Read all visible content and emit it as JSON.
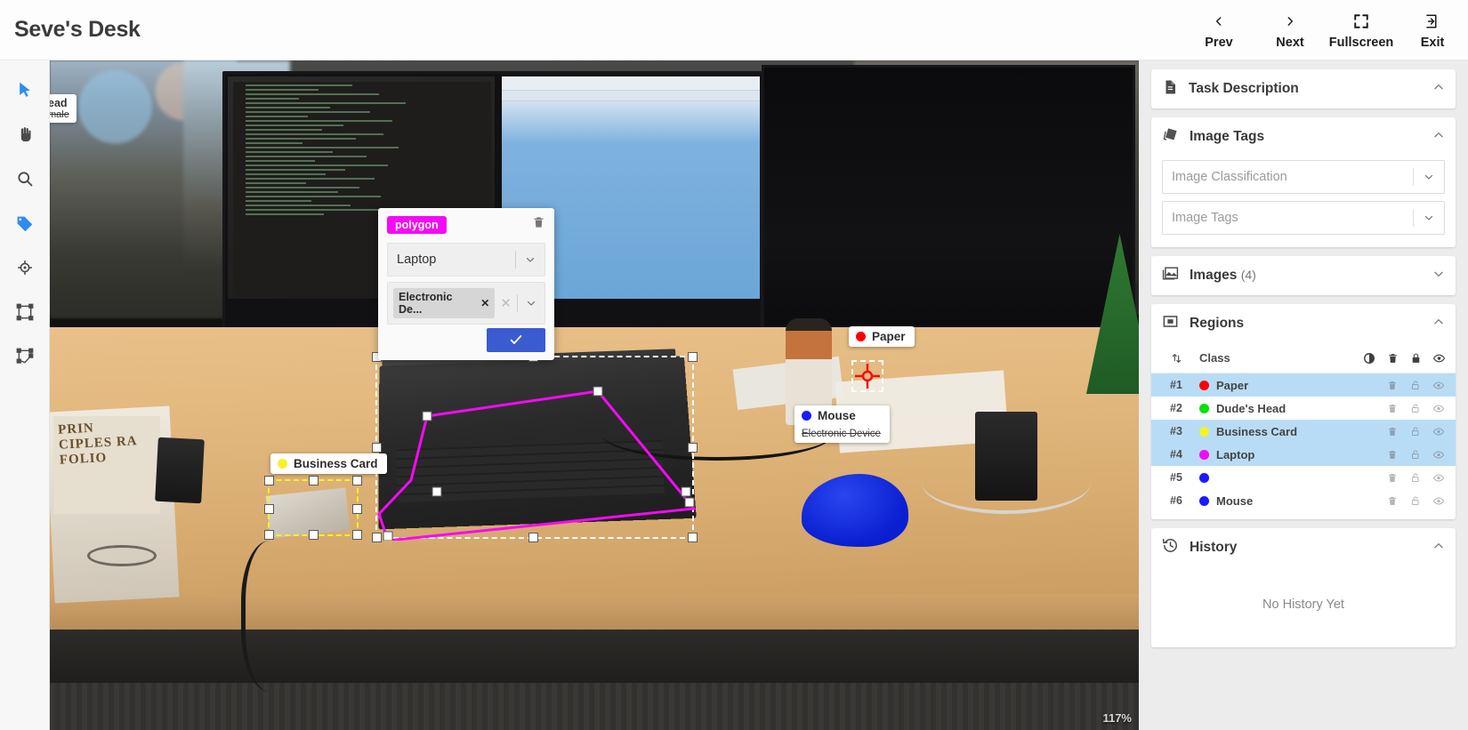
{
  "app": {
    "title": "Seve's Desk"
  },
  "topbar": {
    "prev": {
      "label": "Prev",
      "icon": "chevron-left-icon"
    },
    "next": {
      "label": "Next",
      "icon": "chevron-right-icon"
    },
    "fullscreen": {
      "label": "Fullscreen",
      "icon": "fullscreen-icon"
    },
    "exit": {
      "label": "Exit",
      "icon": "exit-icon"
    }
  },
  "left_toolbar": {
    "tools": [
      {
        "name": "select-tool",
        "icon": "cursor-icon",
        "active": true
      },
      {
        "name": "pan-tool",
        "icon": "hand-icon",
        "active": false
      },
      {
        "name": "zoom-tool",
        "icon": "magnifier-icon",
        "active": false
      },
      {
        "name": "tag-tool",
        "icon": "tag-icon",
        "active": true
      },
      {
        "name": "point-tool",
        "icon": "crosshair-icon",
        "active": false
      },
      {
        "name": "bounding-box-tool",
        "icon": "bounding-box-icon",
        "active": false
      },
      {
        "name": "polygon-tool",
        "icon": "polygon-icon",
        "active": false
      }
    ]
  },
  "canvas": {
    "zoom_level": "117%",
    "labels": [
      {
        "name": "paper-label",
        "text": "Paper",
        "color": "#ff0000"
      },
      {
        "name": "mouse-label",
        "text": "Mouse",
        "color": "#1a1aff",
        "sub": "Electronic Device"
      },
      {
        "name": "business-card-label",
        "text": "Business Card",
        "color": "#f5f22a"
      },
      {
        "name": "dudes-head-label",
        "text": "ead",
        "sub": "male"
      }
    ]
  },
  "edit_popup": {
    "shape_badge": "polygon",
    "class_value": "Laptop",
    "tag_chip": "Electronic De...",
    "chip_remove": "✕",
    "clear_all": "✕",
    "delete_icon": "trash-icon",
    "confirm_icon": "check-icon"
  },
  "sidebar": {
    "task_description": {
      "title": "Task Description",
      "icon": "document-icon",
      "expanded": true
    },
    "image_tags": {
      "title": "Image Tags",
      "icon": "tags-icon",
      "expanded": true,
      "classification_placeholder": "Image Classification",
      "tags_placeholder": "Image Tags"
    },
    "images": {
      "title": "Images",
      "count": "(4)",
      "icon": "image-icon",
      "expanded": false
    },
    "regions": {
      "title": "Regions",
      "icon": "region-icon",
      "expanded": true,
      "columns": {
        "sort": "sort-icon",
        "class": "Class",
        "opacity": "contrast-icon",
        "trash": "trash-icon",
        "lock": "lock-icon",
        "visible": "eye-icon"
      },
      "rows": [
        {
          "id": "#1",
          "class": "Paper",
          "color": "#ff0000",
          "selected": true
        },
        {
          "id": "#2",
          "class": "Dude's Head",
          "color": "#00e500",
          "selected": false
        },
        {
          "id": "#3",
          "class": "Business Card",
          "color": "#f5f22a",
          "selected": true
        },
        {
          "id": "#4",
          "class": "Laptop",
          "color": "#f50af5",
          "selected": true
        },
        {
          "id": "#5",
          "class": "",
          "color": "#1a1aff",
          "selected": false
        },
        {
          "id": "#6",
          "class": "Mouse",
          "color": "#1a1aff",
          "selected": false
        }
      ]
    },
    "history": {
      "title": "History",
      "icon": "history-icon",
      "expanded": true,
      "empty_text": "No History Yet"
    }
  }
}
